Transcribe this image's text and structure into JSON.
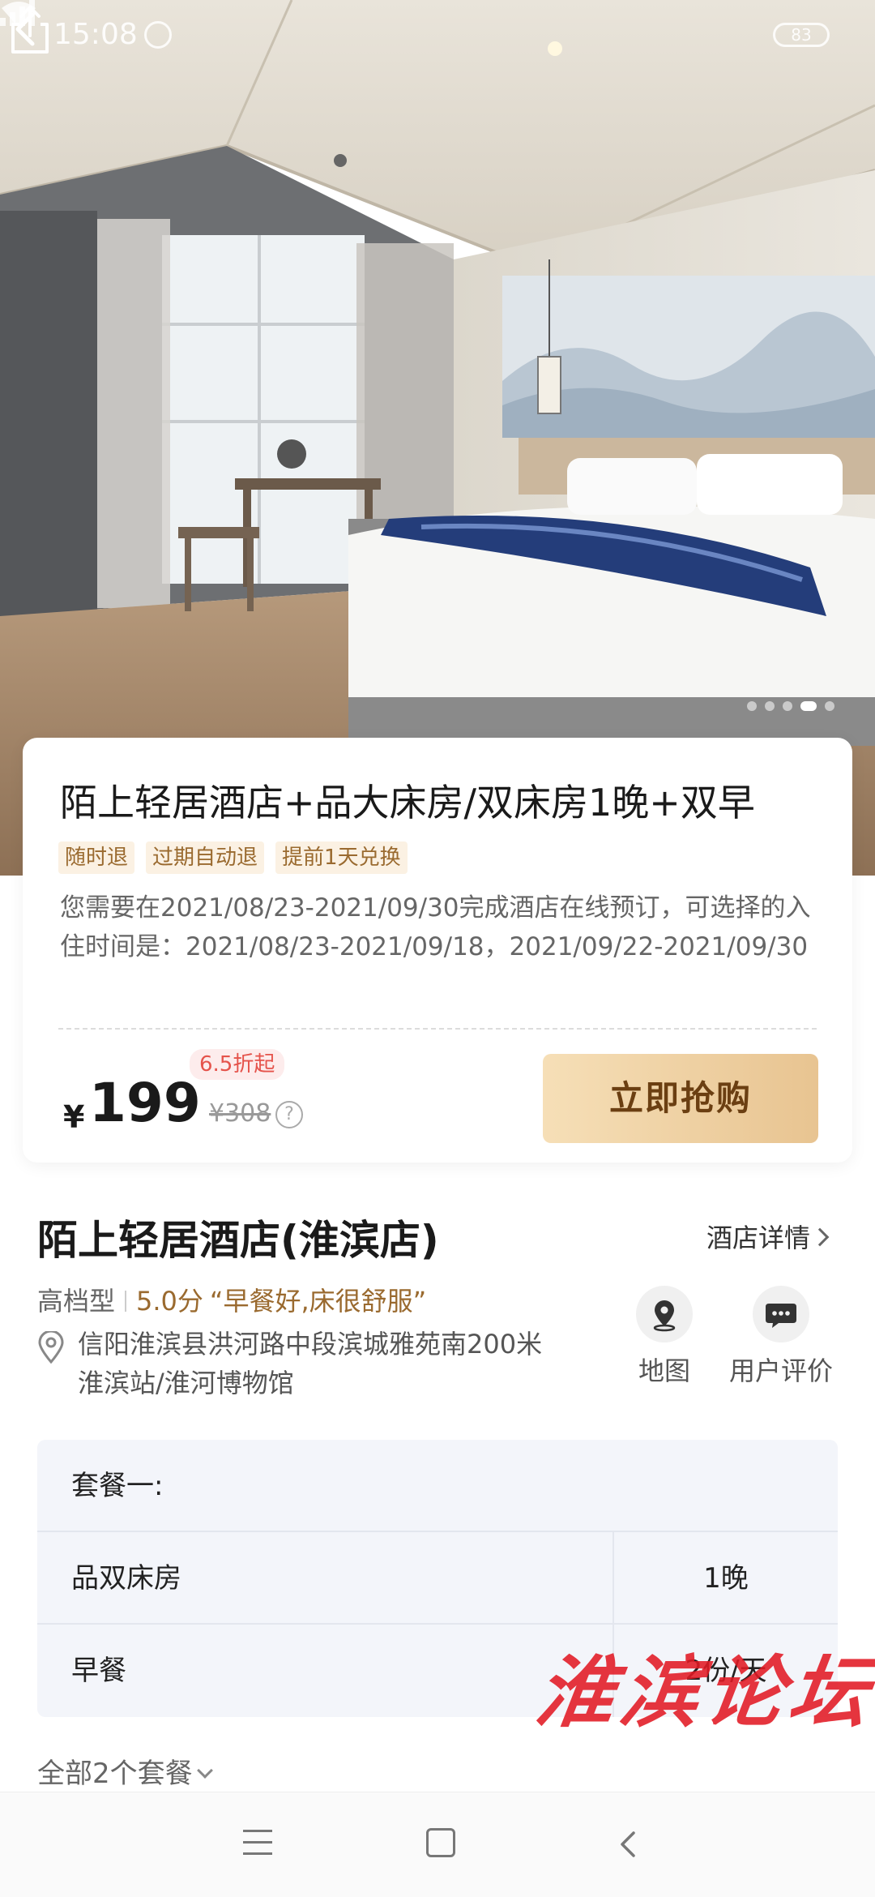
{
  "status_bar": {
    "time": "15:08",
    "battery": "83"
  },
  "hero": {
    "image_icon": "hotel-room-photo",
    "slide_count": 5,
    "active_slide": 4
  },
  "product": {
    "title": "陌上轻居酒店+品大床房/双床房1晚+双早",
    "tags": [
      "随时退",
      "过期自动退",
      "提前1天兑换"
    ],
    "notice": "您需要在2021/08/23-2021/09/30完成酒店在线预订，可选择的入住时间是：2021/08/23-2021/09/18，2021/09/22-2021/09/30",
    "currency": "¥",
    "price": "199",
    "original_price": "¥308",
    "help": "?",
    "discount": "6.5折起",
    "buy_label": "立即抢购"
  },
  "hotel": {
    "name": "陌上轻居酒店(淮滨店)",
    "detail_link": "酒店详情",
    "grade": "高档型",
    "score": "5.0分",
    "comment": "“早餐好,床很舒服”",
    "address": "信阳淮滨县洪河路中段滨城雅苑南200米淮滨站/淮河博物馆",
    "map_label": "地图",
    "review_label": "用户评价"
  },
  "package": {
    "title": "套餐一:",
    "rows": [
      {
        "name": "品双床房",
        "qty": "1晚"
      },
      {
        "name": "早餐",
        "qty": "2份/天"
      }
    ],
    "all_label": "全部2个套餐"
  },
  "watermark": "淮滨论坛",
  "colors": {
    "accent_gold": "#9a6a2f",
    "buy_button": "#e8c491",
    "discount_red": "#e5534b",
    "watermark_red": "#e11923"
  }
}
